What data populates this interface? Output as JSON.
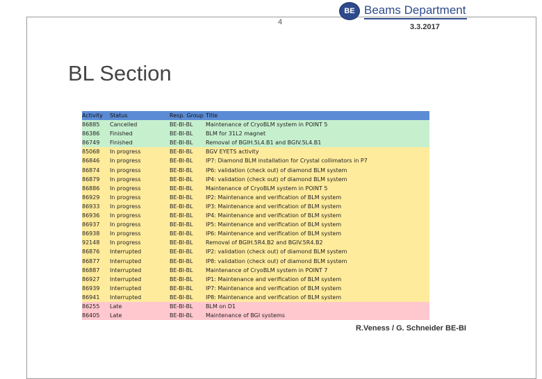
{
  "header": {
    "page_number": "4",
    "date": "3.3.2017",
    "logo_badge": "BE",
    "logo_text": "Beams Department"
  },
  "section_title": "BL Section",
  "colors": {
    "header_bg": "#5b8bd4",
    "cancelled_finished": "#c6efce",
    "in_progress_interrupted": "#ffeb9c",
    "late": "#ffc7ce",
    "logo_blue": "#2e4a8b"
  },
  "table": {
    "columns": [
      "Activity",
      "Status",
      "Resp. Group",
      "Title"
    ],
    "rows": [
      {
        "activity": "86885",
        "status": "Cancelled",
        "group": "BE-BI-BL",
        "title": "Maintenance of CryoBLM system in POINT 5",
        "color": "#c6efce"
      },
      {
        "activity": "86386",
        "status": "Finished",
        "group": "BE-BI-BL",
        "title": "BLM for 31L2 magnet",
        "color": "#c6efce"
      },
      {
        "activity": "86749",
        "status": "Finished",
        "group": "BE-BI-BL",
        "title": "Removal of BGIH.5L4.B1 and BGIV.5L4.B1",
        "color": "#c6efce"
      },
      {
        "activity": "85068",
        "status": "In progress",
        "group": "BE-BI-BL",
        "title": "BGV EYETS activity",
        "color": "#ffeb9c"
      },
      {
        "activity": "86846",
        "status": "In progress",
        "group": "BE-BI-BL",
        "title": "IP7: Diamond BLM installation for Crystal collimators in P7",
        "color": "#ffeb9c"
      },
      {
        "activity": "86874",
        "status": "In progress",
        "group": "BE-BI-BL",
        "title": "IP6: validation (check out) of diamond BLM system",
        "color": "#ffeb9c"
      },
      {
        "activity": "86879",
        "status": "In progress",
        "group": "BE-BI-BL",
        "title": "IP4: validation (check out) of diamond BLM system",
        "color": "#ffeb9c"
      },
      {
        "activity": "86886",
        "status": "In progress",
        "group": "BE-BI-BL",
        "title": "Maintenance of CryoBLM system in POINT 5",
        "color": "#ffeb9c"
      },
      {
        "activity": "86929",
        "status": "In progress",
        "group": "BE-BI-BL",
        "title": "IP2: Maintenance and verification of BLM system",
        "color": "#ffeb9c"
      },
      {
        "activity": "86933",
        "status": "In progress",
        "group": "BE-BI-BL",
        "title": "IP3: Maintenance and verification of BLM system",
        "color": "#ffeb9c"
      },
      {
        "activity": "86936",
        "status": "In progress",
        "group": "BE-BI-BL",
        "title": "IP4: Maintenance and verification of BLM system",
        "color": "#ffeb9c"
      },
      {
        "activity": "86937",
        "status": "In progress",
        "group": "BE-BI-BL",
        "title": "IP5: Maintenance and verification of BLM system",
        "color": "#ffeb9c"
      },
      {
        "activity": "86938",
        "status": "In progress",
        "group": "BE-BI-BL",
        "title": "IP6: Maintenance and verification of BLM system",
        "color": "#ffeb9c"
      },
      {
        "activity": "92148",
        "status": "In progress",
        "group": "BE-BI-BL",
        "title": "Removal of BGIH.5R4.B2 and BGIV.5R4.B2",
        "color": "#ffeb9c"
      },
      {
        "activity": "86876",
        "status": "Interrupted",
        "group": "BE-BI-BL",
        "title": "IP2: validation (check out) of diamond BLM system",
        "color": "#ffeb9c"
      },
      {
        "activity": "86877",
        "status": "Interrupted",
        "group": "BE-BI-BL",
        "title": "IP8: validation (check out) of diamond BLM system",
        "color": "#ffeb9c"
      },
      {
        "activity": "86887",
        "status": "Interrupted",
        "group": "BE-BI-BL",
        "title": "Maintenance of CryoBLM system in POINT 7",
        "color": "#ffeb9c"
      },
      {
        "activity": "86927",
        "status": "Interrupted",
        "group": "BE-BI-BL",
        "title": "IP1: Maintenance and verification of BLM system",
        "color": "#ffeb9c"
      },
      {
        "activity": "86939",
        "status": "Interrupted",
        "group": "BE-BI-BL",
        "title": "IP7: Maintenance and verification of BLM system",
        "color": "#ffeb9c"
      },
      {
        "activity": "86941",
        "status": "Interrupted",
        "group": "BE-BI-BL",
        "title": "IP8: Maintenance and verification of BLM system",
        "color": "#ffeb9c"
      },
      {
        "activity": "86255",
        "status": "Late",
        "group": "BE-BI-BL",
        "title": "BLM on D1",
        "color": "#ffc7ce"
      },
      {
        "activity": "86405",
        "status": "Late",
        "group": "BE-BI-BL",
        "title": "Maintenance of BGI systems",
        "color": "#ffc7ce"
      }
    ]
  },
  "footer": "R.Veness / G. Schneider BE-BI"
}
